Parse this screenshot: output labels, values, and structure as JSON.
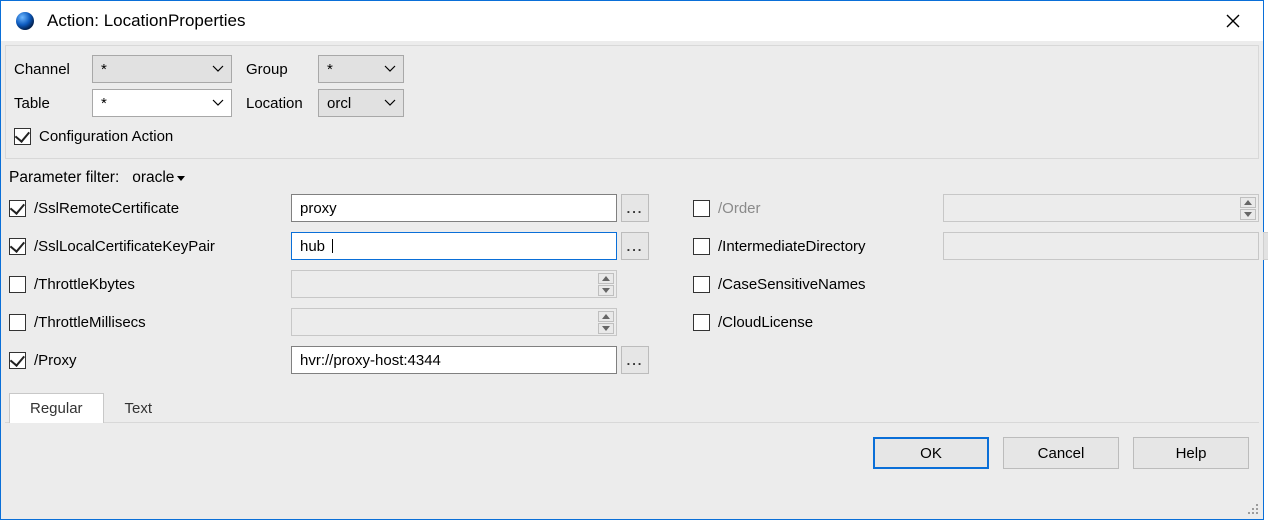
{
  "title": "Action: LocationProperties",
  "top": {
    "labels": {
      "channel": "Channel",
      "group": "Group",
      "table": "Table",
      "location": "Location"
    },
    "values": {
      "channel": "*",
      "group": "*",
      "table": "*",
      "location": "orcl"
    },
    "config_action_label": "Configuration Action",
    "config_action_checked": true
  },
  "param_filter": {
    "label": "Parameter filter:",
    "value": "oracle"
  },
  "params_left": [
    {
      "key": "ssl_remote_cert",
      "label": "/SslRemoteCertificate",
      "checked": true,
      "input_type": "text_dots",
      "value": "proxy",
      "enabled": true,
      "focus": false
    },
    {
      "key": "ssl_local_keypair",
      "label": "/SslLocalCertificateKeyPair",
      "checked": true,
      "input_type": "text_dots",
      "value": "hub",
      "enabled": true,
      "focus": true
    },
    {
      "key": "throttle_kbytes",
      "label": "/ThrottleKbytes",
      "checked": false,
      "input_type": "spin",
      "value": "",
      "enabled": false
    },
    {
      "key": "throttle_millisecs",
      "label": "/ThrottleMillisecs",
      "checked": false,
      "input_type": "spin",
      "value": "",
      "enabled": false
    },
    {
      "key": "proxy",
      "label": "/Proxy",
      "checked": true,
      "input_type": "text_dots",
      "value": "hvr://proxy-host:4344",
      "enabled": true,
      "focus": false
    }
  ],
  "params_right": [
    {
      "key": "order",
      "label": "/Order",
      "checked": false,
      "input_type": "spin",
      "value": "",
      "enabled": false
    },
    {
      "key": "intermediate_dir",
      "label": "/IntermediateDirectory",
      "checked": false,
      "input_type": "text_dots",
      "value": "",
      "enabled": false
    },
    {
      "key": "case_sensitive",
      "label": "/CaseSensitiveNames",
      "checked": false,
      "input_type": "none"
    },
    {
      "key": "cloud_license",
      "label": "/CloudLicense",
      "checked": false,
      "input_type": "none"
    }
  ],
  "tabs": [
    {
      "key": "regular",
      "label": "Regular",
      "active": true
    },
    {
      "key": "text",
      "label": "Text",
      "active": false
    }
  ],
  "buttons": {
    "ok": "OK",
    "cancel": "Cancel",
    "help": "Help"
  },
  "glyphs": {
    "dots": "..."
  }
}
